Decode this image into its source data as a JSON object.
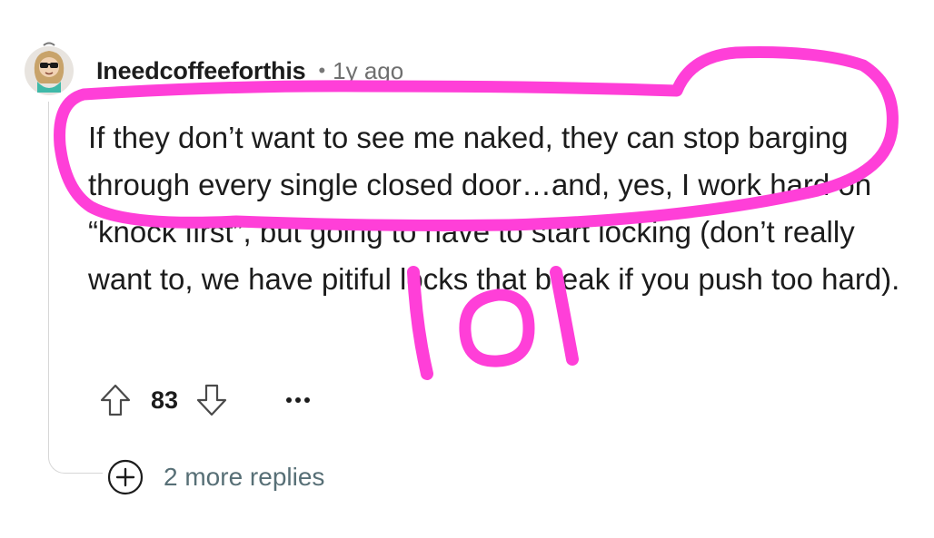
{
  "comment": {
    "username": "Ineedcoffeeforthis",
    "separator": "•",
    "timestamp": "1y ago",
    "body": "If they don’t want to see me naked, they can stop barging through every single closed door…and, yes, I work hard on “knock first”, but going to have to start locking (don’t really want to, we have pitiful locks that break if you push too hard)."
  },
  "actions": {
    "score": "83",
    "upvote_icon": "upvote-arrow-icon",
    "downvote_icon": "downvote-arrow-icon",
    "more_icon": "more-options-icon"
  },
  "replies": {
    "label": "2 more replies",
    "icon": "plus-circle-icon"
  },
  "annotation": {
    "handwritten_text": "lol",
    "color": "#ff3fd8"
  },
  "colors": {
    "text": "#1c1c1c",
    "meta": "#6f6f6f",
    "replies": "#576f76",
    "thread_line": "#d7d7d7",
    "highlight": "#ff3fd8"
  }
}
